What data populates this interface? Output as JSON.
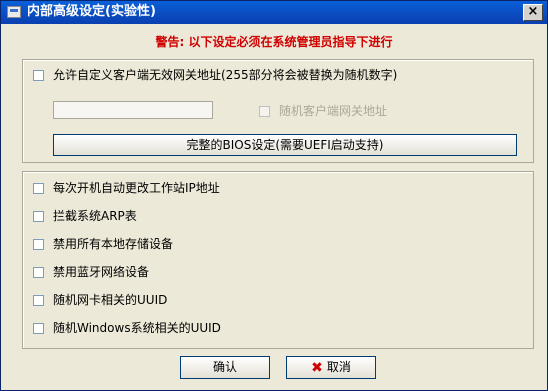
{
  "window": {
    "title": "内部高级设定(实验性)",
    "close_label": "×"
  },
  "warning": "警告: 以下设定必须在系统管理员指导下进行",
  "gateway": {
    "checkbox_label": "允许自定义客户端无效网关地址(255部分将会被替换为随机数字)",
    "input_value": "",
    "random_label": "随机客户端网关地址"
  },
  "bios_button": "完整的BIOS设定(需要UEFI启动支持)",
  "options": [
    "每次开机自动更改工作站IP地址",
    "拦截系统ARP表",
    "禁用所有本地存储设备",
    "禁用蓝牙网络设备",
    "随机网卡相关的UUID",
    "随机Windows系统相关的UUID"
  ],
  "buttons": {
    "ok": "确认",
    "cancel": "取消"
  },
  "icons": {
    "app": "window-app-icon",
    "close": "close-icon",
    "cancel": "x-icon"
  }
}
